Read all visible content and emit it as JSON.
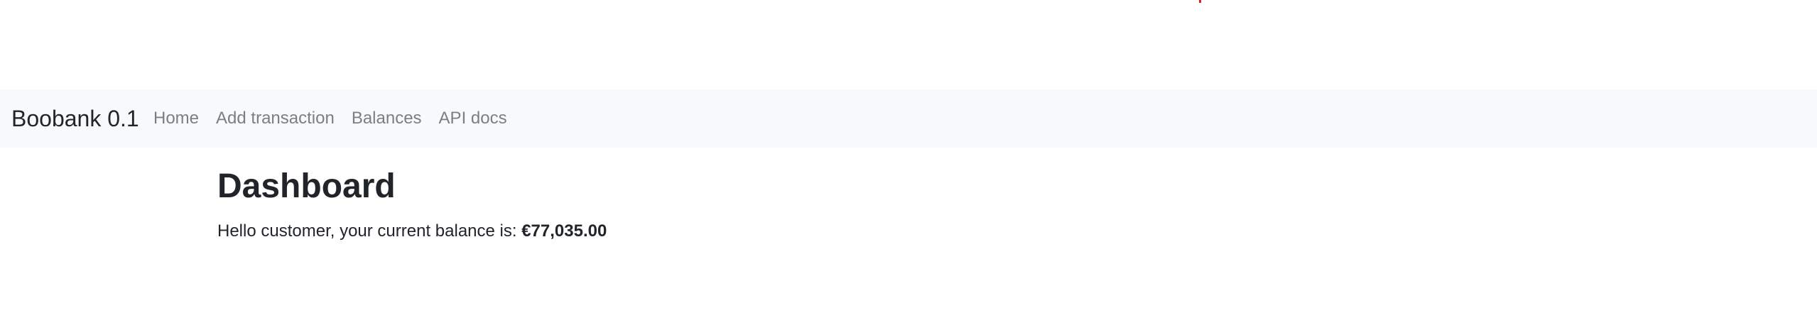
{
  "navbar": {
    "brand": "Boobank 0.1",
    "links": [
      "Home",
      "Add transaction",
      "Balances",
      "API docs"
    ]
  },
  "main": {
    "title": "Dashboard",
    "greeting_prefix": "Hello customer, your current balance is: ",
    "balance": "€77,035.00"
  },
  "colors": {
    "navbar_bg": "#f8f9fa",
    "nav_link": "#7b7f84",
    "text": "#212529"
  }
}
